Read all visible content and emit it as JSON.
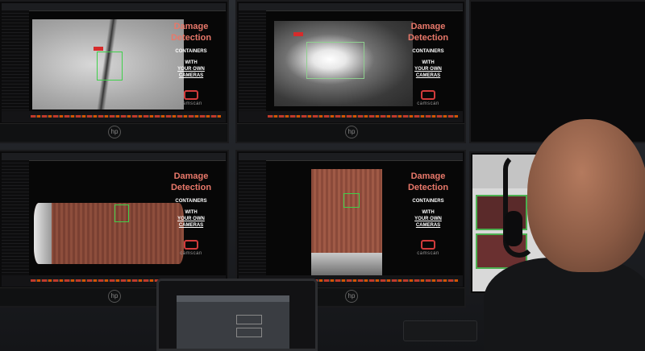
{
  "monitors": [
    {
      "title": "Damage\nDetection",
      "subtitle": "CONTAINERS",
      "line1": "WITH",
      "line2": "YOUR OWN",
      "line3": "CAMERAS",
      "brand": "camscan"
    },
    {
      "title": "Damage\nDetection",
      "subtitle": "CONTAINERS",
      "line1": "WITH",
      "line2": "YOUR OWN",
      "line3": "CAMERAS",
      "brand": "camscan"
    },
    {
      "title": "Damage\nDetection",
      "subtitle": "CONTAINERS",
      "line1": "WITH",
      "line2": "YOUR OWN",
      "line3": "CAMERAS",
      "brand": "camscan"
    },
    {
      "title": "Damage\nDetection",
      "subtitle": "CONTAINERS",
      "line1": "WITH",
      "line2": "YOUR OWN",
      "line3": "CAMERAS",
      "brand": "camscan"
    }
  ],
  "colors": {
    "accent": "#e8786a",
    "logo_red": "#d23b3b",
    "detection_box": "#3fd04a",
    "container_rust": "#8b4a3a"
  }
}
